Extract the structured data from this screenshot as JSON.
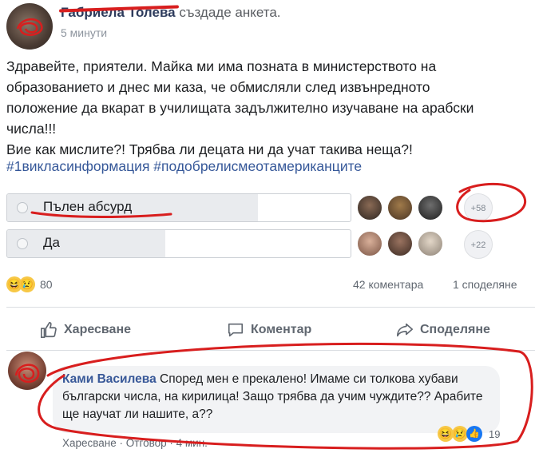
{
  "post": {
    "author_name": "Габриела Толева",
    "action_text": " създаде анкета.",
    "timestamp": "5 минути",
    "text_lines": [
      "Здравейте, приятели. Майка ми има позната в министерството на",
      "образованието и днес ми каза, че обмисляли след извънредното",
      "положение да вкарат в училищата задължително изучаване на арабски",
      "числа!!!",
      "Вие как мислите?! Трябва ли децата ни да учат такива неща?!"
    ],
    "hashtags": "#1викласинформация #подобрелисмеотамериканците"
  },
  "poll": {
    "options": [
      {
        "label": "Пълен абсурд",
        "more_voters": "+58",
        "fill_fraction": 0.73
      },
      {
        "label": "Да",
        "more_voters": "+22",
        "fill_fraction": 0.46
      }
    ]
  },
  "stats": {
    "reaction_count": "80",
    "comments": "42 коментара",
    "shares": "1 споделяне"
  },
  "actions": {
    "like": "Харесване",
    "comment": "Коментар",
    "share": "Споделяне"
  },
  "comment": {
    "author": "Ками Василева",
    "text": " Според мен е прекалено! Имаме си толкова хубави български числа, на кирилица! Защо трябва да учим чуждите?? Арабите ще научат ли нашите, а??",
    "like_label": "Харесване",
    "reply_label": "Отговор",
    "time": "4 мин.",
    "separator": " · ",
    "reaction_count": "19"
  },
  "colors": {
    "link_blue": "#365899",
    "annotation_red": "#d81e1e",
    "muted": "#606770"
  }
}
